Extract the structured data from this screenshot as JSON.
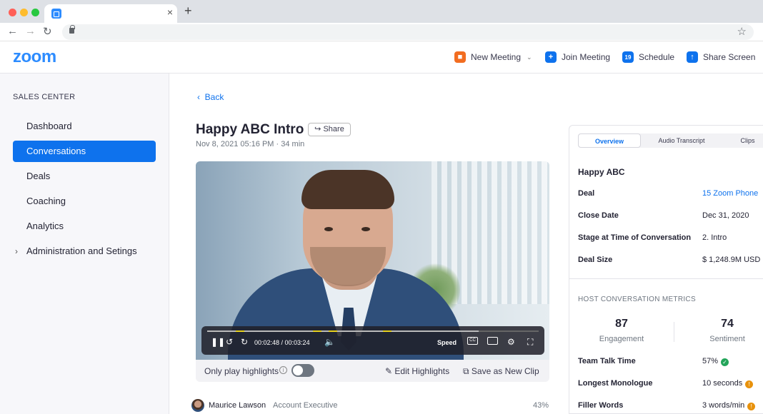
{
  "browser": {
    "tab_icon": "zoom-logo-icon",
    "close_glyph": "×",
    "new_tab_glyph": "+",
    "traffic_lights": [
      "#ff5f57",
      "#febc2e",
      "#28c840"
    ]
  },
  "header": {
    "logo": "zoom",
    "new_meeting": "New Meeting",
    "join_meeting": "Join Meeting",
    "schedule": "Schedule",
    "schedule_day": "19",
    "share_screen": "Share Screen",
    "accent": "#2d8cff"
  },
  "sidebar": {
    "title": "SALES CENTER",
    "items": [
      {
        "label": "Dashboard",
        "active": false
      },
      {
        "label": "Conversations",
        "active": true
      },
      {
        "label": "Deals",
        "active": false
      },
      {
        "label": "Coaching",
        "active": false
      },
      {
        "label": "Analytics",
        "active": false
      },
      {
        "label": "Administration and Setings",
        "active": false
      }
    ]
  },
  "main": {
    "back": "Back",
    "title": "Happy ABC Intro",
    "share": "Share",
    "subtitle": "Nov 8, 2021 05:16 PM · 34 min",
    "player": {
      "time": "00:02:48 / 00:03:24",
      "speed": "Speed",
      "cc": "CC",
      "progress": 0.82
    },
    "highlights_label": "Only play highlights",
    "highlights_on": false,
    "edit_highlights": "Edit Highlights",
    "save_clip": "Save as New Clip",
    "speaker": {
      "name": "Maurice Lawson",
      "role": "Account Executive",
      "pct": "43%"
    }
  },
  "panel": {
    "tabs": [
      "Overview",
      "Audio Transcript",
      "Clips"
    ],
    "active_tab": "Overview",
    "company": "Happy ABC",
    "fields": [
      {
        "key": "Deal",
        "value": "15 Zoom Phone",
        "link": true
      },
      {
        "key": "Close Date",
        "value": "Dec 31, 2020",
        "link": false
      },
      {
        "key": "Stage at Time of Conversation",
        "value": "2. Intro",
        "link": false
      },
      {
        "key": "Deal Size",
        "value": "$ 1,248.9M USD",
        "link": false
      }
    ],
    "metrics_title": "HOST CONVERSATION METRICS",
    "engagement_value": "87",
    "engagement_label": "Engagement",
    "sentiment_value": "74",
    "sentiment_label": "Sentiment",
    "stats": [
      {
        "key": "Team Talk Time",
        "value": "57%",
        "status": "good",
        "color": "#23a55a"
      },
      {
        "key": "Longest Monologue",
        "value": "10 seconds",
        "status": "warning",
        "color": "#e8920c"
      },
      {
        "key": "Filler Words",
        "value": "3 words/min",
        "status": "warning",
        "color": "#e8920c"
      }
    ]
  }
}
